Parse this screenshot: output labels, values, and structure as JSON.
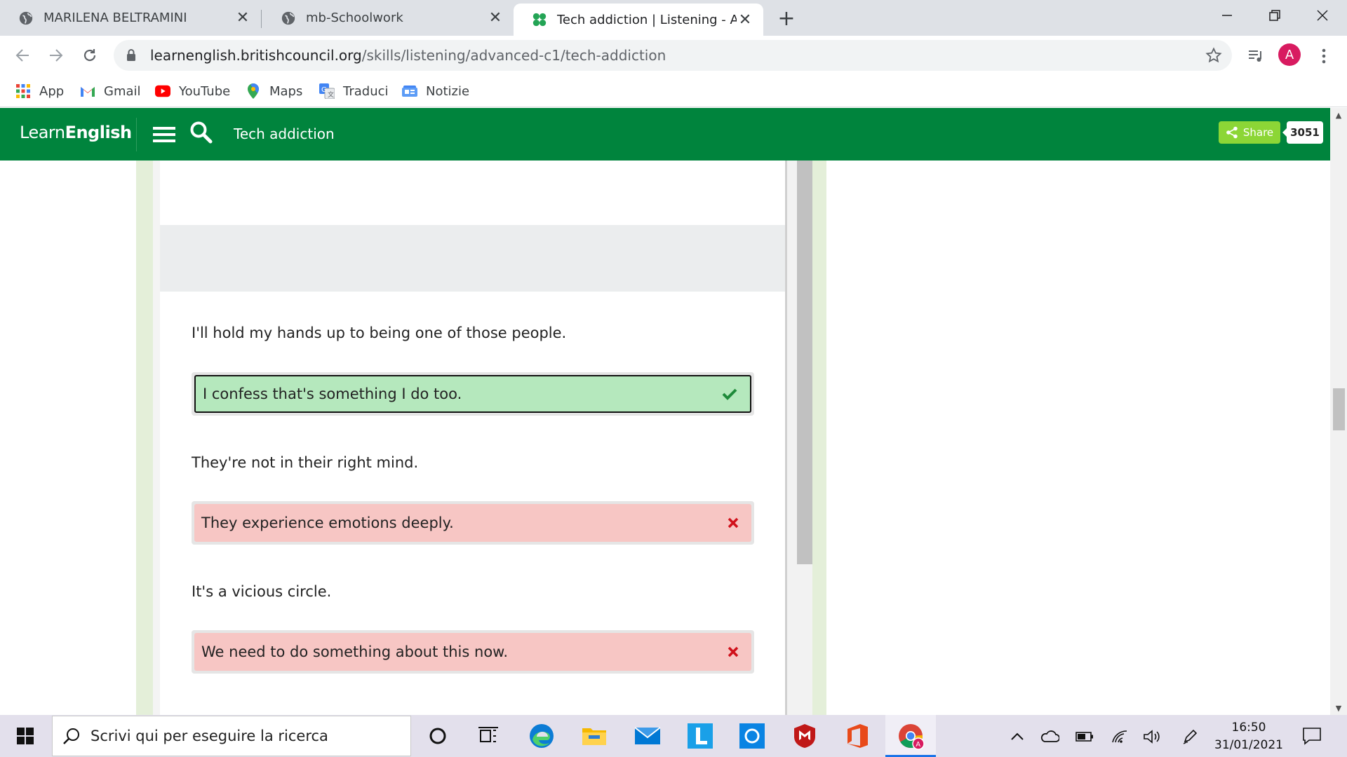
{
  "browser": {
    "tabs": [
      {
        "title": "MARILENA BELTRAMINI",
        "active": false
      },
      {
        "title": "mb-Schoolwork",
        "active": false
      },
      {
        "title": "Tech addiction | Listening - Advanced",
        "active": true
      }
    ],
    "url": {
      "domain": "learnenglish.britishcouncil.org",
      "path": "/skills/listening/advanced-c1/tech-addiction"
    },
    "profile_initial": "A",
    "bookmarks": [
      "App",
      "Gmail",
      "YouTube",
      "Maps",
      "Traduci",
      "Notizie"
    ]
  },
  "site": {
    "logo_light": "Learn",
    "logo_bold": "English",
    "page_title": "Tech addiction",
    "share_label": "Share",
    "share_count": "3051",
    "brand_color": "#00843d"
  },
  "exercise": {
    "items": [
      {
        "statement": "I'll hold my hands up to being one of those people.",
        "answer": "I confess that's something I do too.",
        "result": "correct"
      },
      {
        "statement": "They're not in their right mind.",
        "answer": "They experience emotions deeply.",
        "result": "wrong"
      },
      {
        "statement": "It's a vicious circle.",
        "answer": "We need to do something about this now.",
        "result": "wrong"
      }
    ]
  },
  "taskbar": {
    "search_placeholder": "Scrivi qui per eseguire la ricerca",
    "time": "16:50",
    "date": "31/01/2021"
  }
}
